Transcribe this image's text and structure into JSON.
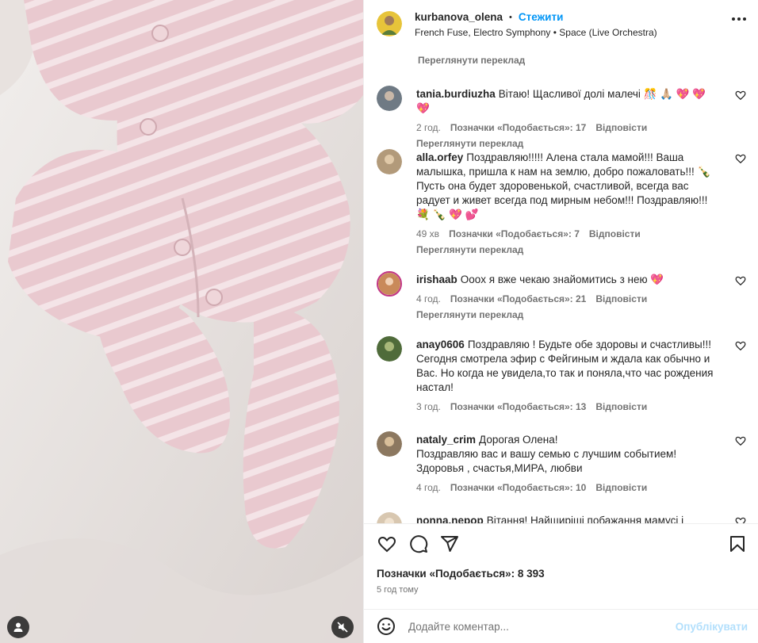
{
  "header": {
    "username": "kurbanova_olena",
    "separator": "•",
    "follow_label": "Стежити",
    "audio": "French Fuse, Electro Symphony • Space (Live Orchestra)"
  },
  "top_translate": "Переглянути переклад",
  "comments": [
    {
      "user": "tania.burdiuzha",
      "text": "Вітаю! Щасливої долі малечі 🎊 🙏🏼 💖 💖 💖",
      "time": "2 год.",
      "likes": "Позначки «Подобається»: 17",
      "reply": "Відповісти",
      "translate": "Переглянути переклад",
      "avatar_color": "#6f7a84"
    },
    {
      "user": "alla.orfey",
      "text": "Поздравляю!!!!! Алена стала мамой!!! Ваша малышка, пришла к нам на землю, добро пожаловать!!! 🍾 Пусть она будет здоровенькой, счастливой, всегда вас радует и живет всегда под мирным небом!!! Поздравляю!!! 💐 🍾 💖 💕",
      "time": "49 хв",
      "likes": "Позначки «Подобається»: 7",
      "reply": "Відповісти",
      "translate": "Переглянути переклад",
      "avatar_color": "#b29a7a"
    },
    {
      "user": "irishaab",
      "text": "Оооx я вже чекаю знайомитись з нею 💖",
      "time": "4 год.",
      "likes": "Позначки «Подобається»: 21",
      "reply": "Відповісти",
      "translate": "Переглянути переклад",
      "avatar_color": "#c98a5a"
    },
    {
      "user": "anay0606",
      "text": "Поздравляю ! Будьте обе здоровы и счастливы!!! Сегодня смотрела эфир с Фейгиным и ждала как обычно и Вас. Но когда не увидела,то так и поняла,что час рождения настал!",
      "time": "3 год.",
      "likes": "Позначки «Подобається»: 13",
      "reply": "Відповісти",
      "avatar_color": "#4f6b3a"
    },
    {
      "user": "nataly_crim",
      "text": "Дорогая Олена!",
      "text2": "Поздравляю вас и вашу семью с лучшим событием!",
      "text3": "Здоровья , счастья,МИРА, любви",
      "time": "4 год.",
      "likes": "Позначки «Подобається»: 10",
      "reply": "Відповісти",
      "avatar_color": "#8c7860"
    },
    {
      "user": "nonna.nepop",
      "text": "Вітання! Найщиріші побажання мамусі і",
      "avatar_color": "#d8c7b0"
    }
  ],
  "footer": {
    "likes": "Позначки «Подобається»: 8 393",
    "time": "5 год тому",
    "comment_placeholder": "Додайте коментар...",
    "publish_label": "Опублікувати"
  },
  "icons": {
    "like": "heart-icon",
    "comment": "comment-icon",
    "share": "share-icon",
    "save": "bookmark-icon",
    "emoji": "emoji-icon",
    "more": "more-icon",
    "user_tag": "user-icon",
    "mute": "muted-speaker-icon"
  },
  "colors": {
    "accent": "#0095f6",
    "muted_text": "#737373",
    "publish_disabled": "#b2dffc"
  }
}
